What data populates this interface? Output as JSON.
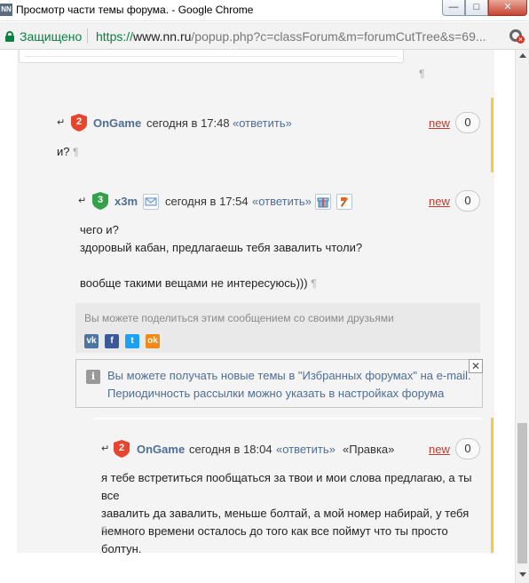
{
  "window": {
    "app_icon": "NN",
    "title": "Просмотр части темы форума. - Google Chrome",
    "min_glyph": "—",
    "max_glyph": "□",
    "close_glyph": "✕"
  },
  "address_bar": {
    "secure_label": "Защищено",
    "url_scheme": "https://",
    "url_host": "www.nn.ru",
    "url_path": "/popup.php?c=classForum&m=forumCutTree&s=69..."
  },
  "pilcrow": "¶",
  "posts": [
    {
      "badge": "2",
      "badge_color": "#e8452f",
      "author": "OnGame",
      "time": "сегодня в 17:48",
      "reply": "«ответить»",
      "new_label": "new",
      "count": "0",
      "text": "и?"
    },
    {
      "badge": "3",
      "badge_color": "#35a04a",
      "author": "x3m",
      "time": "сегодня в 17:54",
      "reply": "«ответить»",
      "new_label": "new",
      "count": "0",
      "text": "чего и?\nздоровый кабан, предлагаешь тебя завалить чтоли?\n\nвообще такими вещами не интересуюсь)))"
    },
    {
      "badge": "2",
      "badge_color": "#e8452f",
      "author": "OnGame",
      "time": "сегодня в 18:04",
      "reply": "«ответить»",
      "edit": "«Правка»",
      "new_label": "new",
      "count": "0",
      "text": "я тебе встретиться пообщаться за твои и мои слова предлагаю, а ты все\nзавалить да завалить, меньше болтай, а мой номер набирай, у тебя\nнемного времени осталось до того как все поймут что ты просто болтун."
    }
  ],
  "share": {
    "title": "Вы можете поделиться этим сообщением со своими друзьями",
    "networks": [
      {
        "name": "vk",
        "glyph": "vk",
        "color": "#4c75a3"
      },
      {
        "name": "facebook",
        "glyph": "f",
        "color": "#3b5998"
      },
      {
        "name": "twitter",
        "glyph": "t",
        "color": "#1da1f2"
      },
      {
        "name": "odnoklassniki",
        "glyph": "ok",
        "color": "#f28a1a"
      }
    ]
  },
  "info": {
    "icon": "i",
    "text": "Вы можете получать новые темы в \"Избранных форумах\" на e-mail.\nПериодичность рассылки можно указать в настройках форума",
    "close": "✕"
  }
}
